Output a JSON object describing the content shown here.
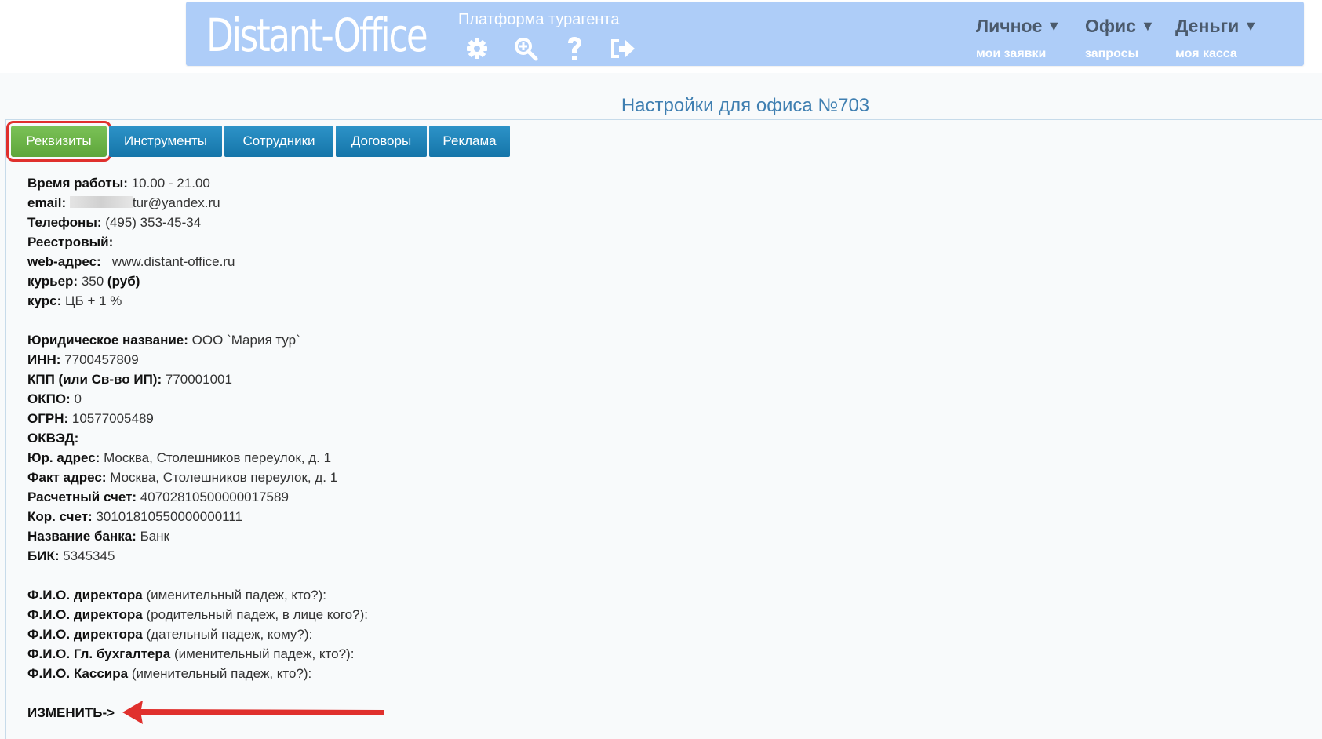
{
  "header": {
    "logo": "Distant-Office",
    "platform_label": "Платформа турагента",
    "icons": [
      "gear-icon",
      "zoom-in-icon",
      "help-icon",
      "logout-icon"
    ],
    "menus": [
      {
        "label": "Личное",
        "sub": "мои заявки"
      },
      {
        "label": "Офис",
        "sub": "запросы"
      },
      {
        "label": "Деньги",
        "sub": "моя касса"
      }
    ],
    "arrow_glyph": "▼"
  },
  "page": {
    "title": "Настройки для офиса №703"
  },
  "tabs": [
    {
      "label": "Реквизиты",
      "active": true
    },
    {
      "label": "Инструменты",
      "active": false
    },
    {
      "label": "Сотрудники",
      "active": false
    },
    {
      "label": "Договоры",
      "active": false
    },
    {
      "label": "Реклама",
      "active": false
    }
  ],
  "details": {
    "work_hours_label": "Время работы:",
    "work_hours_value": "10.00 - 21.00",
    "email_label": "email:",
    "email_value": "tur@yandex.ru",
    "phones_label": "Телефоны:",
    "phones_value": "(495) 353-45-34",
    "registry_label": "Реестровый:",
    "web_label": "web-адрес:",
    "web_value": "www.distant-office.ru",
    "courier_label": "курьер:",
    "courier_value": "350",
    "courier_unit": "(руб)",
    "rate_label": "курс:",
    "rate_value": "ЦБ + 1 %",
    "legal_name_label": "Юридическое название:",
    "legal_name_value": "ООО `Мария тур`",
    "inn_label": "ИНН:",
    "inn_value": "7700457809",
    "kpp_label": "КПП (или Св-во ИП):",
    "kpp_value": "770001001",
    "okpo_label": "ОКПО:",
    "okpo_value": "0",
    "ogrn_label": "ОГРН:",
    "ogrn_value": "10577005489",
    "okved_label": "ОКВЭД:",
    "legal_address_label": "Юр. адрес:",
    "legal_address_value": "Москва, Столешников переулок, д. 1",
    "actual_address_label": "Факт адрес:",
    "actual_address_value": "Москва, Столешников переулок, д. 1",
    "account_label": "Расчетный счет:",
    "account_value": "40702810500000017589",
    "corr_account_label": "Кор. счет:",
    "corr_account_value": "30101810550000000111",
    "bank_label": "Название банка:",
    "bank_value": "Банк",
    "bik_label": "БИК:",
    "bik_value": "5345345"
  },
  "persons": [
    {
      "label": "Ф.И.О. директора",
      "hint": "(именительный падеж, кто?):"
    },
    {
      "label": "Ф.И.О. директора",
      "hint": "(родительный падеж, в лице кого?):"
    },
    {
      "label": "Ф.И.О. директора",
      "hint": "(дательный падеж, кому?):"
    },
    {
      "label": "Ф.И.О. Гл. бухгалтера",
      "hint": "(именительный падеж, кто?):"
    },
    {
      "label": "Ф.И.О. Кассира",
      "hint": "(именительный падеж, кто?):"
    }
  ],
  "change_link": "ИЗМЕНИТЬ->",
  "colors": {
    "header_bg": "#aecdf8",
    "tab_blue": "#1f86bd",
    "tab_active_green": "#6cb449",
    "highlight_red": "#e0302d",
    "title_blue": "#3f7fb1"
  }
}
